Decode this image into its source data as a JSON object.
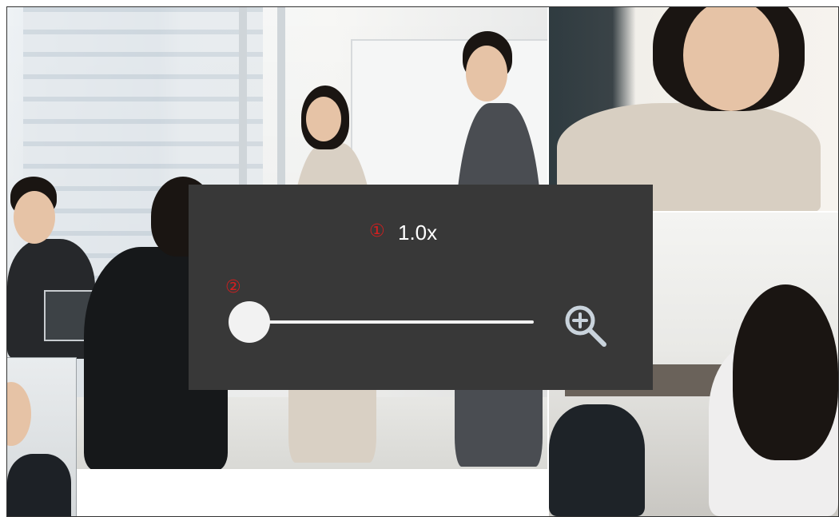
{
  "zoom_overlay": {
    "marker_1": "①",
    "marker_2": "②",
    "zoom_level": "1.0x",
    "slider_value": 0.0
  },
  "icons": {
    "zoom_in": "zoom-in-icon"
  },
  "colors": {
    "panel_background": "#383838",
    "marker": "#d21f1f",
    "slider": "#f2f2f2",
    "icon": "#c9d3dc"
  }
}
